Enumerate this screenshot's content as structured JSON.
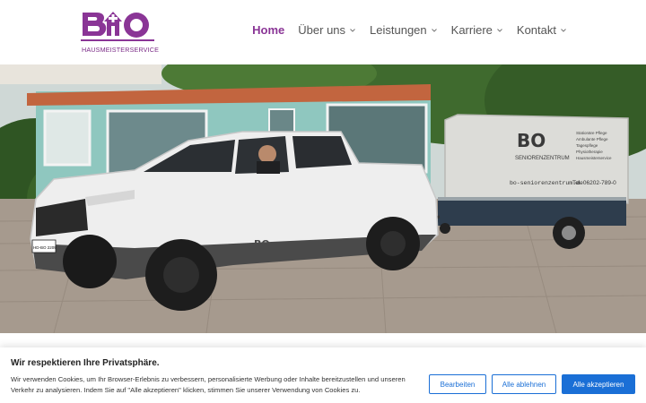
{
  "brand": {
    "logo_letters": "BO",
    "logo_subtitle": "HAUSMEISTERSERVICE",
    "color": "#8a3596"
  },
  "nav": {
    "items": [
      {
        "label": "Home",
        "active": true,
        "dropdown": false
      },
      {
        "label": "Über uns",
        "active": false,
        "dropdown": true
      },
      {
        "label": "Leistungen",
        "active": false,
        "dropdown": true
      },
      {
        "label": "Karriere",
        "active": false,
        "dropdown": true
      },
      {
        "label": "Kontakt",
        "active": false,
        "dropdown": true
      }
    ]
  },
  "hero": {
    "trailer_logo": "BO",
    "trailer_subtitle": "SENIORENZENTRUM",
    "trailer_list": [
      "Stationäre Pflege",
      "Ambulante Pflege",
      "Tagespflege",
      "Physiotherapie",
      "Hausmeisterservice"
    ],
    "trailer_url": "bo-seniorenzentrum.de",
    "trailer_phone": "Tel. 06202-789-0",
    "truck_door_logo": "BO",
    "plate": "HD-BO 2209"
  },
  "cookie": {
    "title": "Wir respektieren Ihre Privatsphäre.",
    "text": "Wir verwenden Cookies, um Ihr Browser-Erlebnis zu verbessern, personalisierte Werbung oder Inhalte bereitzustellen und unseren Verkehr zu analysieren. Indem Sie auf \"Alle akzeptieren\" klicken, stimmen Sie unserer Verwendung von Cookies zu.",
    "buttons": {
      "customize": "Bearbeiten",
      "reject": "Alle ablehnen",
      "accept": "Alle akzeptieren"
    },
    "accent": "#1a6fd6"
  }
}
